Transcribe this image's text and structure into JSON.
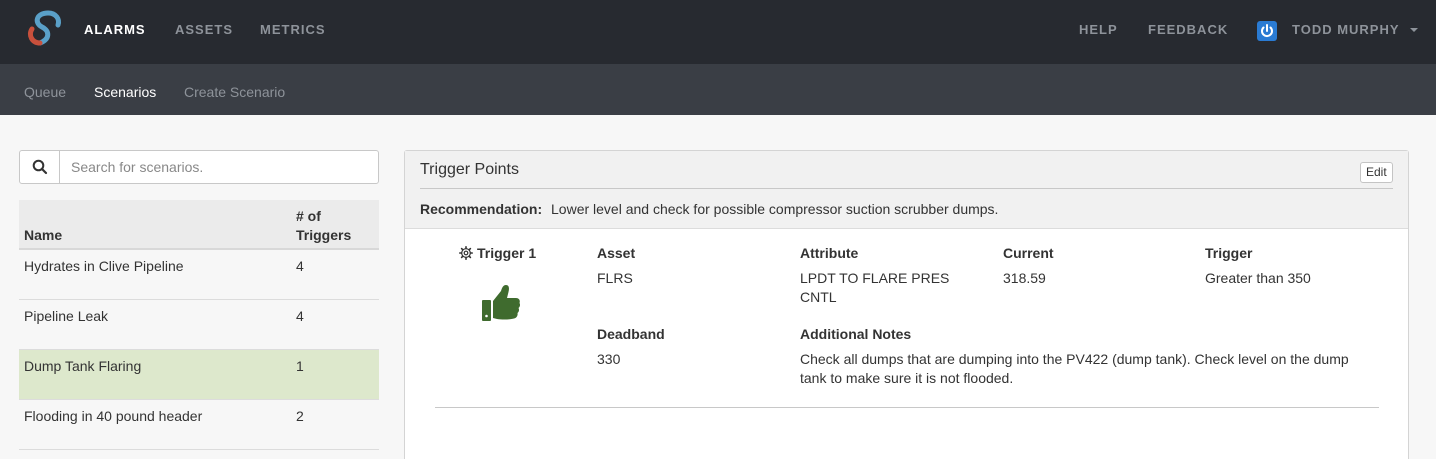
{
  "nav": {
    "items": [
      "ALARMS",
      "ASSETS",
      "METRICS"
    ],
    "help": "HELP",
    "feedback": "FEEDBACK",
    "user": "TODD MURPHY"
  },
  "subnav": {
    "items": [
      "Queue",
      "Scenarios",
      "Create Scenario"
    ]
  },
  "search": {
    "placeholder": "Search for scenarios."
  },
  "scenarios": {
    "columns": [
      "Name",
      "# of",
      "Triggers"
    ],
    "rows": [
      {
        "name": "Hydrates in Clive Pipeline",
        "triggers": "4"
      },
      {
        "name": "Pipeline Leak",
        "triggers": "4"
      },
      {
        "name": "Dump Tank Flaring",
        "triggers": "1"
      },
      {
        "name": "Flooding in 40 pound header",
        "triggers": "2"
      }
    ]
  },
  "panel": {
    "title": "Trigger Points",
    "edit_label": "Edit",
    "recommendation_label": "Recommendation:",
    "recommendation": "Lower level and check for possible compressor suction scrubber dumps.",
    "trigger": {
      "label": "Trigger 1",
      "asset_label": "Asset",
      "asset": "FLRS",
      "attribute_label": "Attribute",
      "attribute_line1": "LPDT TO FLARE PRES",
      "attribute_line2": "CNTL",
      "current_label": "Current",
      "current": "318.59",
      "trigger_label": "Trigger",
      "trigger": "Greater than 350",
      "deadband_label": "Deadband",
      "deadband": "330",
      "notes_label": "Additional Notes",
      "notes_line1": "Check all dumps that are dumping into the PV422 (dump tank). Check level on the dump",
      "notes_line2": "tank to make sure it is not flooded."
    }
  },
  "colors": {
    "topbar": "#272a30",
    "subbar": "#3a3e45",
    "selected_row": "#dde8cc",
    "thumb": "#3f6b2e",
    "user_icon": "#2a7bd3"
  }
}
